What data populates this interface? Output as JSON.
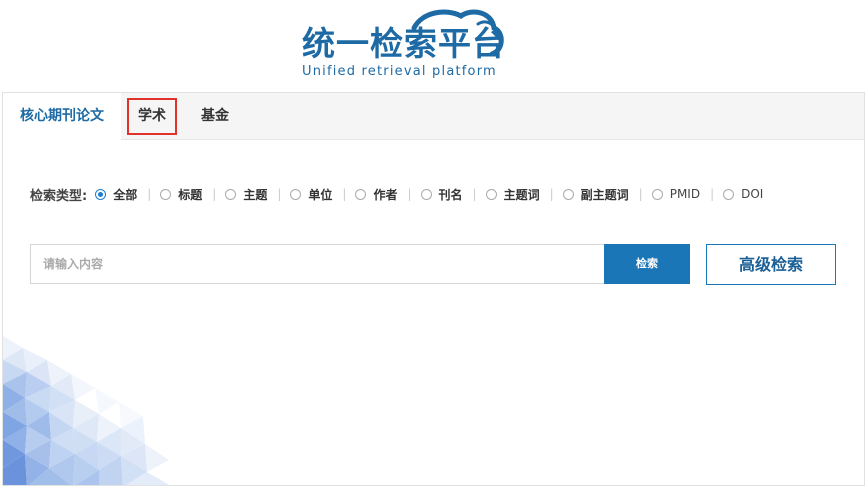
{
  "logo": {
    "title": "统一检索平台",
    "subtitle": "Unified retrieval platform",
    "brand_color": "#1d6aa5"
  },
  "tabs": [
    {
      "label": "核心期刊论文",
      "active": true
    },
    {
      "label": "学术",
      "active": false,
      "highlighted": true
    },
    {
      "label": "基金",
      "active": false
    }
  ],
  "search_types": {
    "label": "检索类型:",
    "options": [
      {
        "label": "全部",
        "selected": true
      },
      {
        "label": "标题",
        "selected": false
      },
      {
        "label": "主题",
        "selected": false
      },
      {
        "label": "单位",
        "selected": false
      },
      {
        "label": "作者",
        "selected": false
      },
      {
        "label": "刊名",
        "selected": false
      },
      {
        "label": "主题词",
        "selected": false
      },
      {
        "label": "副主题词",
        "selected": false
      },
      {
        "label": "PMID",
        "selected": false
      },
      {
        "label": "DOI",
        "selected": false
      }
    ]
  },
  "search": {
    "placeholder": "请输入内容",
    "value": "",
    "button_label": "检索",
    "advanced_label": "高级检索",
    "accent_color": "#1a76b6"
  },
  "highlight_color": "#e0322a"
}
